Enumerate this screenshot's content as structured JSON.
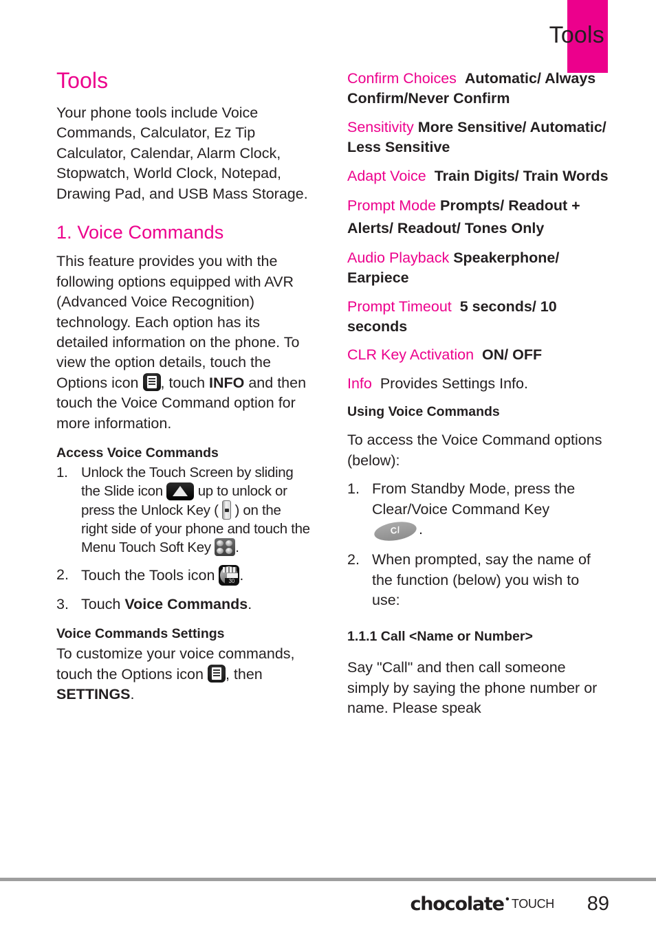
{
  "header": {
    "running_title": "Tools",
    "tab_color": "#ec008c"
  },
  "colors": {
    "accent_pink": "#ec008c",
    "body_text": "#231f20",
    "footer_rule": "#9e9e9e"
  },
  "left_column": {
    "title": "Tools",
    "intro": "Your phone tools include Voice Commands, Calculator, Ez Tip Calculator, Calendar, Alarm Clock, Stopwatch, World Clock, Notepad, Drawing Pad, and USB Mass Storage.",
    "section_heading": "1.  Voice Commands",
    "feature_para_1": "This feature provides you with the following options equipped with AVR (Advanced Voice Recognition) technology. Each option has its detailed information on the phone. To view the option details, touch the Options icon",
    "feature_para_2": ", touch ",
    "feature_info_bold": "INFO",
    "feature_para_3": " and then touch the Voice Command option for more information.",
    "access_heading": "Access Voice Commands",
    "steps": [
      {
        "num": "1.",
        "part_a": "Unlock the Touch Screen by sliding the Slide icon",
        "part_b": "up to unlock or press the Unlock Key (",
        "part_c": ") on the right side of your phone and touch the Menu Touch Soft Key",
        "part_d": "."
      },
      {
        "num": "2.",
        "part_a": "Touch the Tools icon",
        "part_d": "."
      },
      {
        "num": "3.",
        "part_a": "Touch ",
        "bold": "Voice Commands",
        "part_d": "."
      }
    ],
    "settings_heading": "Voice Commands Settings",
    "settings_para_1": "To customize your voice commands, touch the Options icon",
    "settings_para_2": ", then",
    "settings_bold": "SETTINGS",
    "settings_para_3": "."
  },
  "right_column": {
    "settings": [
      {
        "term": "Confirm Choices",
        "def": "Automatic/ Always Confirm/Never Confirm"
      },
      {
        "term": "Sensitivity",
        "def": "More Sensitive/ Automatic/ Less Sensitive"
      },
      {
        "term": "Adapt Voice",
        "def": "Train Digits/ Train Words"
      },
      {
        "term": "Prompt Mode",
        "def": "Prompts/ Readout + Alerts/ Readout/ Tones Only"
      },
      {
        "term": "Audio Playback",
        "def": "Speakerphone/ Earpiece"
      },
      {
        "term": "Prompt Timeout",
        "def": "5 seconds/ 10 seconds"
      },
      {
        "term": "CLR Key Activation",
        "def": "ON/ OFF"
      },
      {
        "term": "Info",
        "def": "Provides Settings Info.",
        "def_regular": true
      }
    ],
    "using_heading": "Using Voice Commands",
    "using_para": "To access the Voice Command options (below):",
    "steps": [
      {
        "num": "1.",
        "part_a": "From Standby Mode, press the Clear/Voice Command Key",
        "part_d": "."
      },
      {
        "num": "2.",
        "part_a": "When prompted, say the name of the function (below) you wish to use:"
      }
    ],
    "subsection_heading": "1.1.1 Call <Name or Number>",
    "subsection_para": "Say \"Call\" and then call someone simply by saying the phone number or name. Please speak"
  },
  "icons": {
    "options": "options-list-icon",
    "slide": "slide-unlock-icon",
    "unlock_key": "unlock-hardware-key-icon",
    "menu_key": "menu-touch-soft-key-icon",
    "tools": "tools-app-icon",
    "clr_key_label": "C/"
  },
  "footer": {
    "brand": "chocolate",
    "brand_mark": "•",
    "brand_sub": "TOUCH",
    "page_number": "89"
  }
}
